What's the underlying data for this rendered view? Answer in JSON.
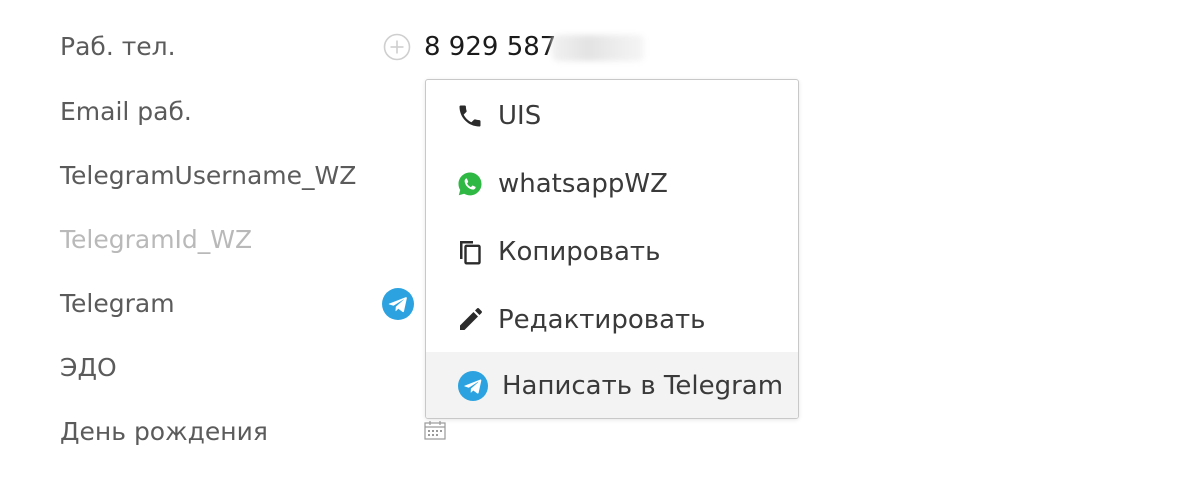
{
  "fields": {
    "work_phone": {
      "label": "Раб. тел.",
      "value": "8 929 587-"
    },
    "work_email": {
      "label": "Email раб."
    },
    "telegram_username": {
      "label": "TelegramUsername_WZ"
    },
    "telegram_id": {
      "label": "TelegramId_WZ"
    },
    "telegram": {
      "label": "Telegram"
    },
    "edo": {
      "label": "ЭДО"
    },
    "birthday": {
      "label": "День рождения"
    }
  },
  "context_menu": {
    "items": [
      {
        "label": "UIS",
        "icon": "phone-icon"
      },
      {
        "label": "whatsappWZ",
        "icon": "whatsapp-icon"
      },
      {
        "label": "Копировать",
        "icon": "copy-icon"
      },
      {
        "label": "Редактировать",
        "icon": "pencil-icon"
      },
      {
        "label": "Написать в Telegram",
        "icon": "telegram-icon"
      }
    ],
    "highlighted_index": 4
  },
  "colors": {
    "label": "#5b5b5b",
    "label_muted": "#b9b9b9",
    "value": "#1b1b1b",
    "menu_text": "#3a3a3a",
    "whatsapp_green": "#2fb843",
    "telegram_blue": "#2ca3e0",
    "highlight_bg": "#f3f3f3"
  }
}
